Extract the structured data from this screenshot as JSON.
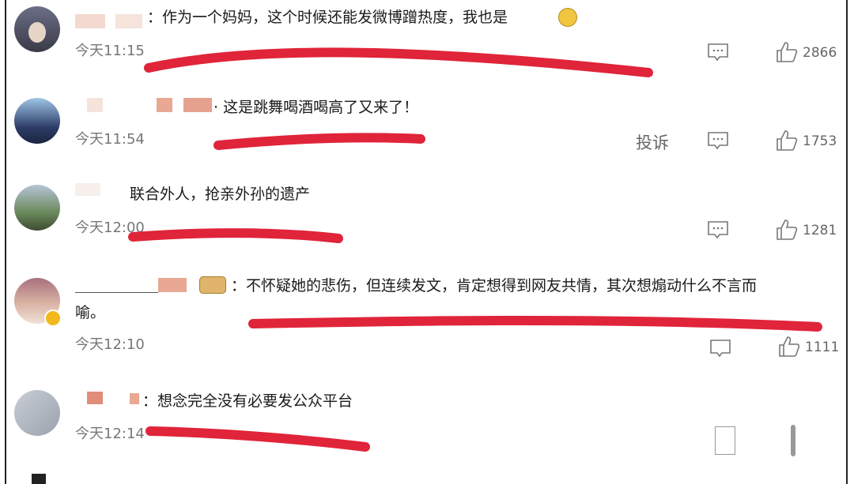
{
  "comments": [
    {
      "text": "：作为一个妈妈，这个时候还能发微博蹭热度，我也是",
      "time": "今天11:15",
      "likes": "2866"
    },
    {
      "text": "· 这是跳舞喝酒喝高了又来了！",
      "time": "今天11:54",
      "likes": "1753",
      "report": "投诉"
    },
    {
      "text": "联合外人，抢亲外孙的遗产",
      "time": "今天12:00",
      "likes": "1281"
    },
    {
      "text_line1": "：不怀疑她的悲伤，但连续发文，肯定想得到网友共情，其次想煽动什么不言而",
      "text_line2": "喻。",
      "time": "今天12:10",
      "likes": "1111"
    },
    {
      "text": "：想念完全没有必要发公众平台",
      "time": "今天12:14"
    }
  ],
  "colors": {
    "scribble": "#e0243a",
    "time": "#777777",
    "text": "#1a1a1a"
  },
  "icons": [
    "comment-icon",
    "thumb-up-icon",
    "emoji-icon",
    "verified-badge-icon"
  ]
}
